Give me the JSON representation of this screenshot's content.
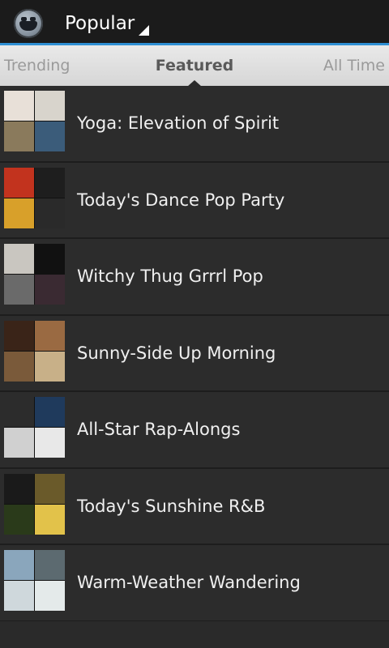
{
  "header": {
    "title": "Popular",
    "app_icon": "app-mascot-icon",
    "accent_color": "#2f8fd3"
  },
  "tabs": {
    "previous": "Trending",
    "current": "Featured",
    "next": "All Time"
  },
  "playlists": [
    {
      "title": "Yoga: Elevation of Spirit",
      "cover_colors": [
        "#e8e0d8",
        "#d8d4cc",
        "#8a7a5c",
        "#3b5c7a"
      ]
    },
    {
      "title": "Today's Dance Pop Party",
      "cover_colors": [
        "#c2331e",
        "#1e1e1e",
        "#d8a02a",
        "#2a2a2a"
      ]
    },
    {
      "title": "Witchy Thug Grrrl Pop",
      "cover_colors": [
        "#c9c6c0",
        "#111111",
        "#6a6a6a",
        "#3a2a32"
      ]
    },
    {
      "title": "Sunny-Side Up Morning",
      "cover_colors": [
        "#3a2418",
        "#9a6a42",
        "#7a5a3a",
        "#c8b088"
      ]
    },
    {
      "title": "All-Star Rap-Alongs",
      "cover_colors": [
        "#2c2c2c",
        "#1f3a5c",
        "#d0d0d0",
        "#e8e8e8"
      ]
    },
    {
      "title": "Today's Sunshine R&B",
      "cover_colors": [
        "#1a1a1a",
        "#6a5a2a",
        "#2a3a1a",
        "#e2c24a"
      ]
    },
    {
      "title": "Warm-Weather Wandering",
      "cover_colors": [
        "#8aa6bc",
        "#5c6a70",
        "#cfd8dc",
        "#e4eaea"
      ]
    }
  ]
}
